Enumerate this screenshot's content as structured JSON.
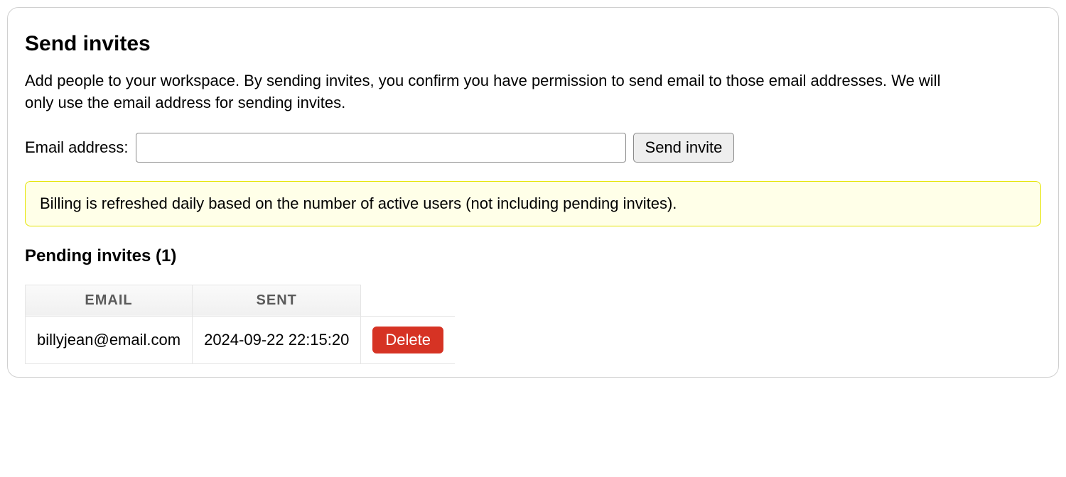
{
  "section": {
    "title": "Send invites",
    "description": "Add people to your workspace. By sending invites, you confirm you have permission to send email to those email addresses. We will only use the email address for sending invites."
  },
  "form": {
    "email_label": "Email address:",
    "email_value": "",
    "send_button_label": "Send invite"
  },
  "notice": {
    "text": "Billing is refreshed daily based on the number of active users (not including pending invites)."
  },
  "pending": {
    "title": "Pending invites (1)",
    "headers": {
      "email": "EMAIL",
      "sent": "SENT"
    },
    "rows": [
      {
        "email": "billyjean@email.com",
        "sent": "2024-09-22 22:15:20",
        "delete_label": "Delete"
      }
    ]
  }
}
